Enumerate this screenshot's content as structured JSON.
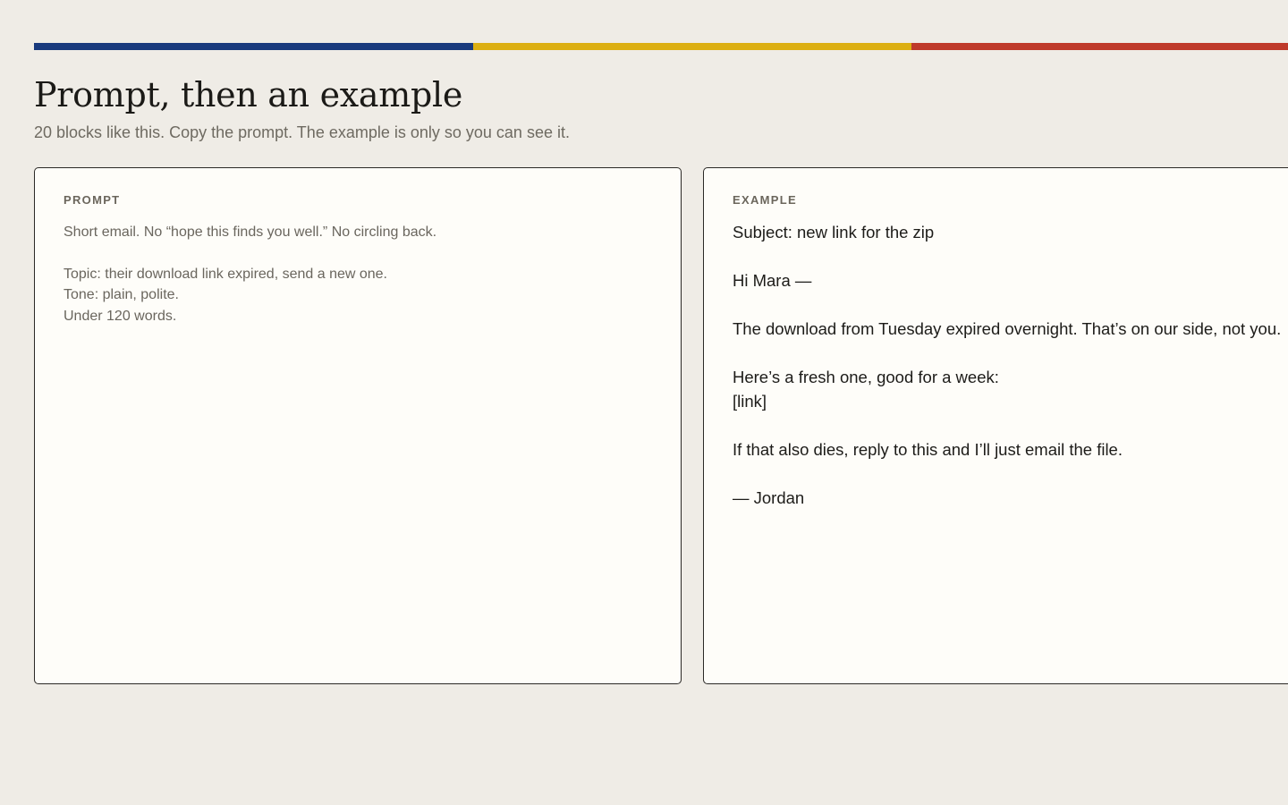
{
  "accent_colors": [
    "#193a7d",
    "#dcaf12",
    "#bf3a2b"
  ],
  "header": {
    "title": "Prompt, then an example",
    "subtitle": "20 blocks like this. Copy the prompt. The example is only so you can see it."
  },
  "prompt_card": {
    "label": "PROMPT",
    "lines": [
      "Short email. No “hope this finds you well.” No circling back.",
      "Topic: their download link expired, send a new one.",
      "Tone: plain, polite.",
      "Under 120 words."
    ]
  },
  "example_card": {
    "label": "EXAMPLE",
    "lines": [
      "Subject: new link for the zip",
      "Hi Mara —",
      "The download from Tuesday expired overnight. That’s on our side, not you.",
      "Here’s a fresh one, good for a week:",
      "[link]",
      "If that also dies, reply to this and I’ll just email the file.",
      "— Jordan"
    ]
  }
}
